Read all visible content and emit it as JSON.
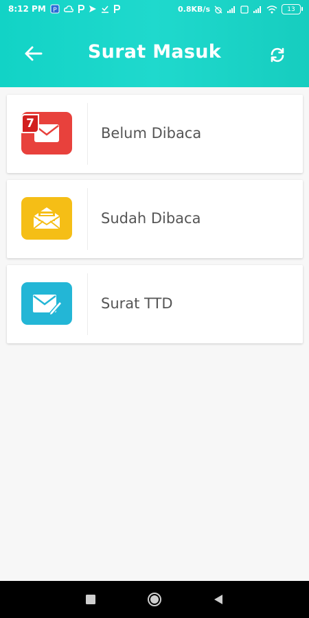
{
  "status_bar": {
    "time": "8:12 PM",
    "net_speed": "0.8KB/s",
    "battery": "13"
  },
  "header": {
    "title": "Surat Masuk",
    "back_icon": "arrow-left-icon",
    "refresh_icon": "refresh-icon"
  },
  "menu": {
    "items": [
      {
        "label": "Belum Dibaca",
        "icon": "envelope-closed-icon",
        "color": "#e8413c",
        "badge": "7"
      },
      {
        "label": "Sudah Dibaca",
        "icon": "envelope-open-icon",
        "color": "#f5be16"
      },
      {
        "label": "Surat TTD",
        "icon": "envelope-sign-icon",
        "color": "#23b6d6"
      }
    ]
  },
  "colors": {
    "header_bg": "#16d1c4",
    "navbar_bg": "#000000"
  }
}
